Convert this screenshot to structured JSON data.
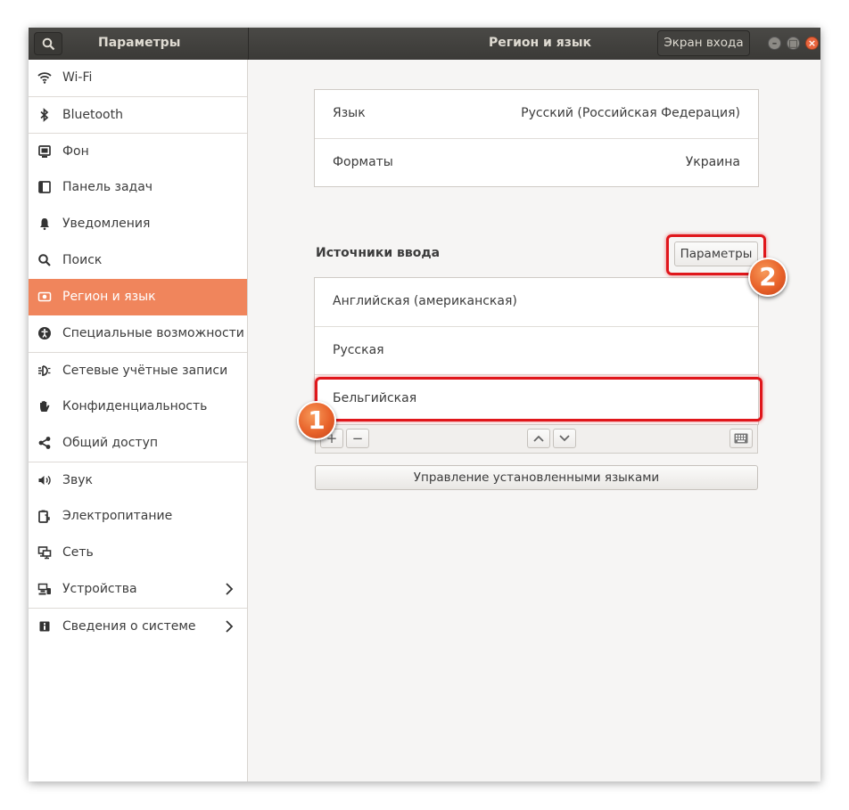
{
  "titlebar": {
    "left_title": "Параметры",
    "center_title": "Регион и язык",
    "login_screen_button": "Экран входа"
  },
  "sidebar": {
    "items": [
      {
        "label": "Wi-Fi",
        "icon": "wifi-icon"
      },
      {
        "label": "Bluetooth",
        "icon": "bluetooth-icon"
      },
      {
        "label": "Фон",
        "icon": "background-icon"
      },
      {
        "label": "Панель задач",
        "icon": "dock-icon"
      },
      {
        "label": "Уведомления",
        "icon": "bell-icon"
      },
      {
        "label": "Поиск",
        "icon": "search-icon"
      },
      {
        "label": "Регион и язык",
        "icon": "region-icon",
        "active": true
      },
      {
        "label": "Специальные возможности",
        "icon": "accessibility-icon"
      },
      {
        "label": "Сетевые учётные записи",
        "icon": "online-accounts-icon"
      },
      {
        "label": "Конфиденциальность",
        "icon": "privacy-hand-icon"
      },
      {
        "label": "Общий доступ",
        "icon": "share-icon"
      },
      {
        "label": "Звук",
        "icon": "speaker-icon"
      },
      {
        "label": "Электропитание",
        "icon": "power-icon"
      },
      {
        "label": "Сеть",
        "icon": "network-icon"
      },
      {
        "label": "Устройства",
        "icon": "devices-icon",
        "chevron": true
      },
      {
        "label": "Сведения о системе",
        "icon": "info-icon",
        "chevron": true
      }
    ]
  },
  "main": {
    "language": {
      "label": "Язык",
      "value": "Русский (Российская Федерация)"
    },
    "formats": {
      "label": "Форматы",
      "value": "Украина"
    },
    "input_sources": {
      "title": "Источники ввода",
      "options_button": "Параметры",
      "items": [
        "Английская (американская)",
        "Русская",
        "Бельгийская"
      ]
    },
    "toolbar": {
      "add": "+",
      "remove": "−",
      "up": "˄",
      "down": "˅"
    },
    "manage_languages_button": "Управление установленными языками"
  },
  "annotations": {
    "badge_1": "1",
    "badge_2": "2"
  },
  "colors": {
    "accent": "#f0855c",
    "highlight": "#e0161b",
    "titlebar": "#3f3e3b"
  }
}
